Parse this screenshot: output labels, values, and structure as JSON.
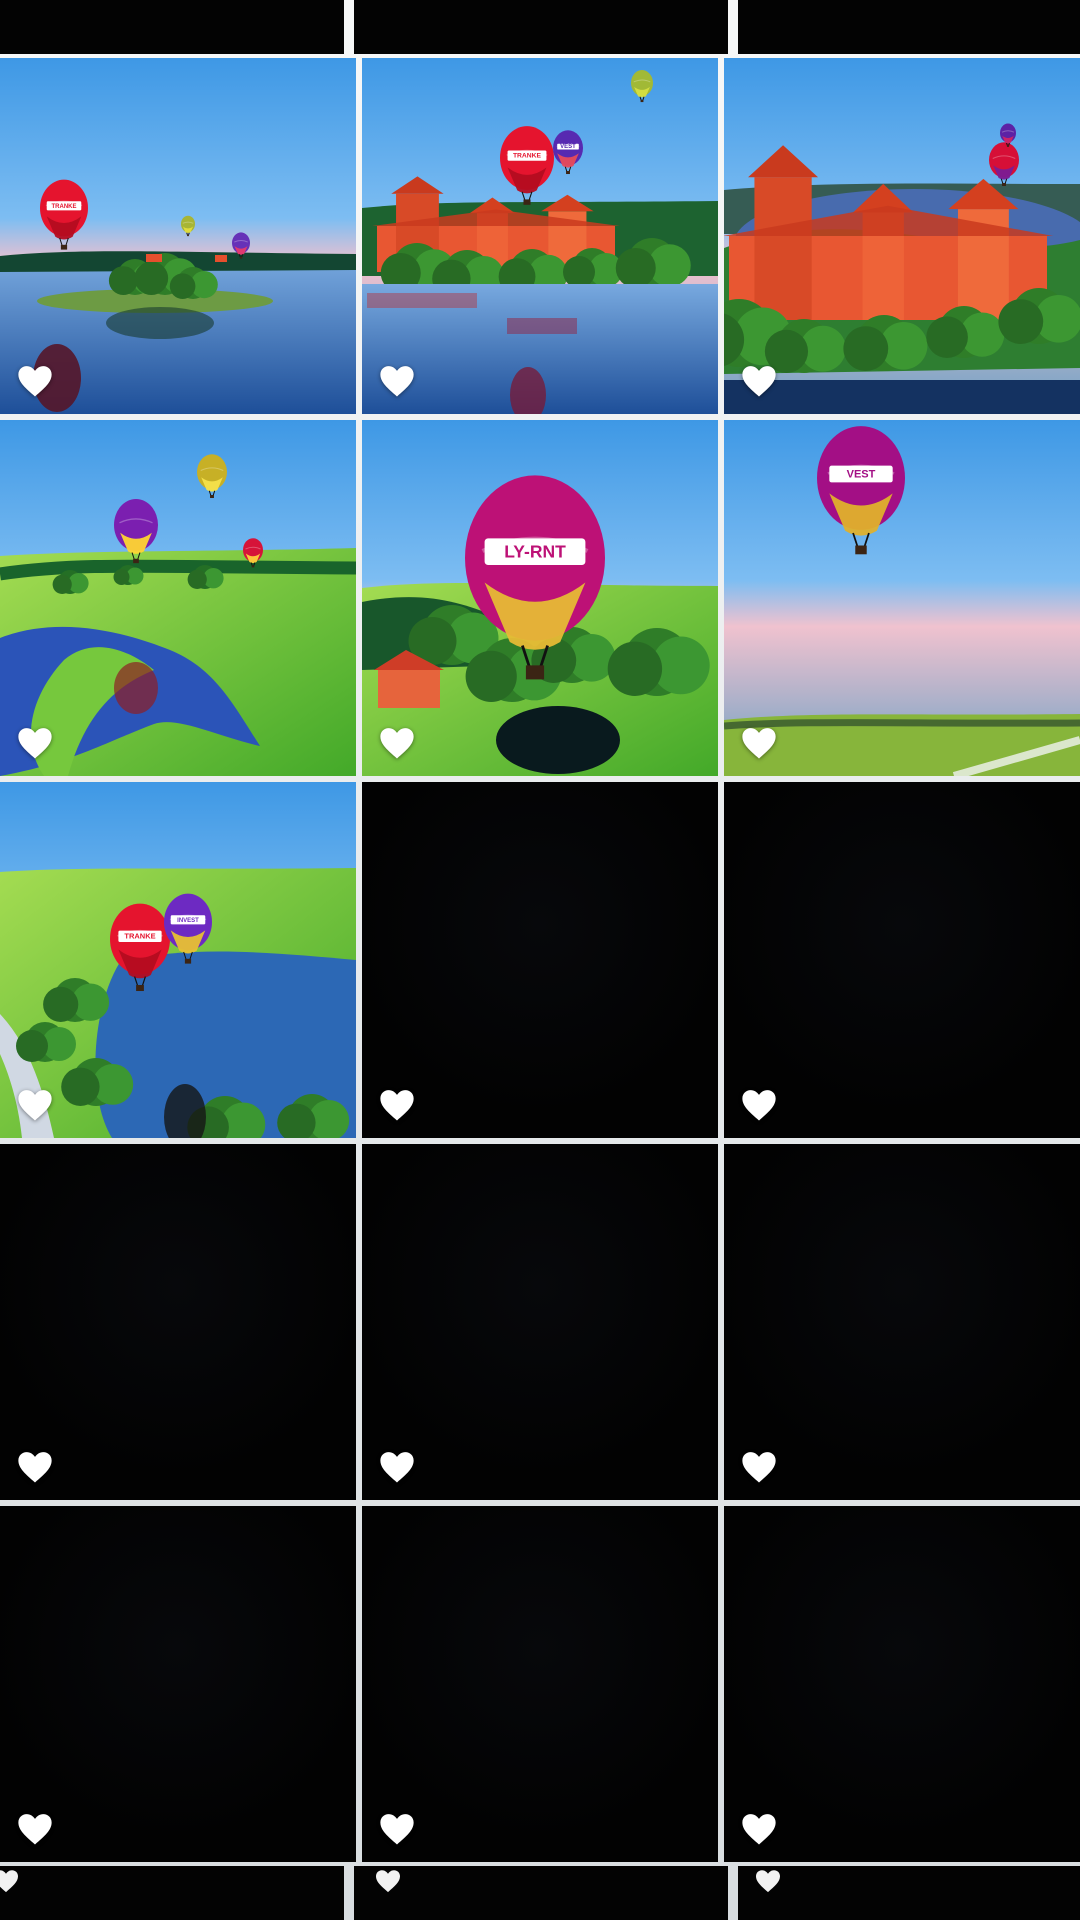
{
  "grid": {
    "rows": 5,
    "columns": 3,
    "favorite_icon": "heart-icon",
    "tiles": [
      {
        "id": "tile-1",
        "kind": "photo",
        "scene": "island-balloons",
        "balloon_text": "TRANKE"
      },
      {
        "id": "tile-2",
        "kind": "photo",
        "scene": "castle-balloons",
        "balloon_text": "TRANKE"
      },
      {
        "id": "tile-3",
        "kind": "photo",
        "scene": "castle-aerial",
        "balloon_text": ""
      },
      {
        "id": "tile-4",
        "kind": "photo",
        "scene": "meadow-river-balloons",
        "balloon_text": ""
      },
      {
        "id": "tile-5",
        "kind": "photo",
        "scene": "pink-balloon-house",
        "balloon_text": "LY-RNT"
      },
      {
        "id": "tile-6",
        "kind": "photo",
        "scene": "high-balloon-field",
        "balloon_text": "VEST"
      },
      {
        "id": "tile-7",
        "kind": "photo",
        "scene": "lake-road-balloons",
        "balloon_text": "TRANKE"
      },
      {
        "id": "tile-8",
        "kind": "blank"
      },
      {
        "id": "tile-9",
        "kind": "blank"
      },
      {
        "id": "tile-10",
        "kind": "blank"
      },
      {
        "id": "tile-11",
        "kind": "blank"
      },
      {
        "id": "tile-12",
        "kind": "blank"
      },
      {
        "id": "tile-13",
        "kind": "blank"
      },
      {
        "id": "tile-14",
        "kind": "blank"
      },
      {
        "id": "tile-15",
        "kind": "blank"
      }
    ]
  },
  "colors": {
    "background": "#f7f8f8",
    "tile_black": "#020202",
    "heart": "#ffffff",
    "sky": "#3f9ae6",
    "balloon_red": "#e5142e",
    "balloon_pink": "#b0127c",
    "balloon_gold": "#e1b22f",
    "castle": "#e85732",
    "grass": "#76c83d",
    "water": "#2c68b5"
  }
}
